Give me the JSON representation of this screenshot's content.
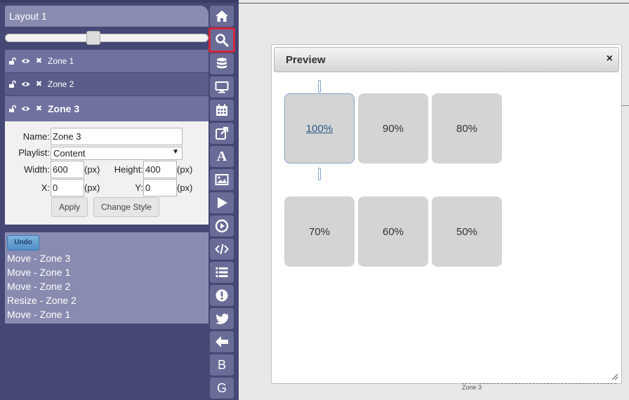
{
  "layout": {
    "title": "Layout 1",
    "zoom_slider": 0.43
  },
  "zones": [
    {
      "name": "Zone 1"
    },
    {
      "name": "Zone 2"
    },
    {
      "name": "Zone 3"
    }
  ],
  "zone_form": {
    "name_label": "Name:",
    "name_value": "Zone 3",
    "playlist_label": "Playlist:",
    "playlist_value": "Content",
    "width_label": "Width:",
    "width_value": "600",
    "height_label": "Height:",
    "height_value": "400",
    "x_label": "X:",
    "x_value": "0",
    "y_label": "Y:",
    "y_value": "0",
    "unit": "(px)",
    "apply_label": "Apply",
    "change_style_label": "Change Style"
  },
  "history": {
    "undo_label": "Undo",
    "items": [
      "Move - Zone 3",
      "Move - Zone 1",
      "Move - Zone 2",
      "Resize - Zone 2",
      "Move - Zone 1"
    ]
  },
  "toolbar": {
    "buttons": [
      {
        "icon": "home-icon"
      },
      {
        "icon": "search-icon",
        "active": true
      },
      {
        "icon": "database-icon"
      },
      {
        "icon": "monitor-icon"
      },
      {
        "icon": "calendar-icon"
      },
      {
        "icon": "external-link-icon"
      },
      {
        "icon": "text-icon",
        "letter": "A"
      },
      {
        "icon": "image-icon"
      },
      {
        "icon": "play-icon"
      },
      {
        "icon": "play-circle-icon"
      },
      {
        "icon": "code-icon"
      },
      {
        "icon": "list-icon"
      },
      {
        "icon": "alert-icon"
      },
      {
        "icon": "twitter-icon"
      },
      {
        "icon": "arrow-left-icon"
      },
      {
        "icon": "b-icon",
        "letter": "B"
      },
      {
        "icon": "g-icon",
        "letter": "G"
      }
    ]
  },
  "preview": {
    "title": "Preview",
    "close": "×",
    "zoom_levels": [
      "100%",
      "90%",
      "80%",
      "70%",
      "60%",
      "50%"
    ],
    "selected": "100%"
  },
  "canvas": {
    "ghost_label": "Zone 3"
  },
  "colors": {
    "panel": "#454775",
    "active_border": "#d1273b",
    "undo": "#5a95cc"
  }
}
